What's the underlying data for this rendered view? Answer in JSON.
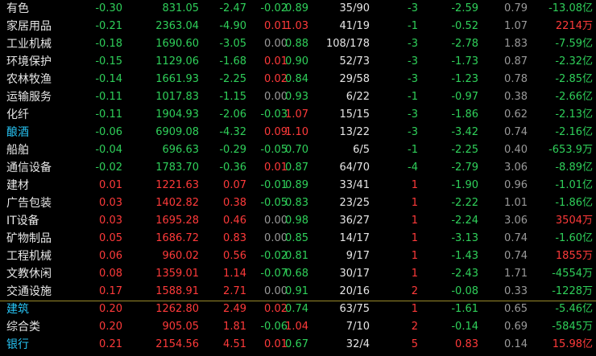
{
  "columns": [
    "name",
    "chg",
    "price",
    "up",
    "speed",
    "lb",
    "updown",
    "daychg",
    "c8",
    "c9",
    "c10"
  ],
  "rows": [
    {
      "name": "有色",
      "name_color": "white",
      "chg": "-0.30",
      "price": "831.05",
      "up": "-2.47",
      "speed": "-0.02",
      "lb": "0.89",
      "updown": "35/90",
      "daychg": "-3",
      "c8": "-2.59",
      "c9": "0.79",
      "c10": "-13.08亿",
      "colors": {
        "chg": "green",
        "price": "green",
        "up": "green",
        "speed": "green",
        "lb": "green",
        "updown": "white",
        "daychg": "green",
        "c8": "green",
        "c9": "gray",
        "c10": "green"
      }
    },
    {
      "name": "家居用品",
      "name_color": "white",
      "chg": "-0.21",
      "price": "2363.04",
      "up": "-4.90",
      "speed": "0.01",
      "lb": "1.03",
      "updown": "41/19",
      "daychg": "-1",
      "c8": "-0.52",
      "c9": "1.07",
      "c10": "2214万",
      "colors": {
        "chg": "green",
        "price": "green",
        "up": "green",
        "speed": "red",
        "lb": "red",
        "updown": "white",
        "daychg": "green",
        "c8": "green",
        "c9": "gray",
        "c10": "red"
      }
    },
    {
      "name": "工业机械",
      "name_color": "white",
      "chg": "-0.18",
      "price": "1690.60",
      "up": "-3.05",
      "speed": "0.00",
      "lb": "0.88",
      "updown": "108/178",
      "daychg": "-3",
      "c8": "-2.78",
      "c9": "1.83",
      "c10": "-7.59亿",
      "colors": {
        "chg": "green",
        "price": "green",
        "up": "green",
        "speed": "gray",
        "lb": "green",
        "updown": "white",
        "daychg": "green",
        "c8": "green",
        "c9": "gray",
        "c10": "green"
      }
    },
    {
      "name": "环境保护",
      "name_color": "white",
      "chg": "-0.15",
      "price": "1129.06",
      "up": "-1.68",
      "speed": "0.01",
      "lb": "0.90",
      "updown": "52/73",
      "daychg": "-3",
      "c8": "-1.73",
      "c9": "0.87",
      "c10": "-2.32亿",
      "colors": {
        "chg": "green",
        "price": "green",
        "up": "green",
        "speed": "red",
        "lb": "green",
        "updown": "white",
        "daychg": "green",
        "c8": "green",
        "c9": "gray",
        "c10": "green"
      }
    },
    {
      "name": "农林牧渔",
      "name_color": "white",
      "chg": "-0.14",
      "price": "1661.93",
      "up": "-2.25",
      "speed": "0.02",
      "lb": "0.84",
      "updown": "29/58",
      "daychg": "-3",
      "c8": "-1.23",
      "c9": "0.78",
      "c10": "-2.85亿",
      "colors": {
        "chg": "green",
        "price": "green",
        "up": "green",
        "speed": "red",
        "lb": "green",
        "updown": "white",
        "daychg": "green",
        "c8": "green",
        "c9": "gray",
        "c10": "green"
      }
    },
    {
      "name": "运输服务",
      "name_color": "white",
      "chg": "-0.11",
      "price": "1017.83",
      "up": "-1.15",
      "speed": "0.00",
      "lb": "0.93",
      "updown": "6/22",
      "daychg": "-1",
      "c8": "-0.97",
      "c9": "0.38",
      "c10": "-2.66亿",
      "colors": {
        "chg": "green",
        "price": "green",
        "up": "green",
        "speed": "gray",
        "lb": "green",
        "updown": "white",
        "daychg": "green",
        "c8": "green",
        "c9": "gray",
        "c10": "green"
      }
    },
    {
      "name": "化纤",
      "name_color": "white",
      "chg": "-0.11",
      "price": "1904.93",
      "up": "-2.06",
      "speed": "-0.03",
      "lb": "1.07",
      "updown": "15/15",
      "daychg": "-3",
      "c8": "-1.86",
      "c9": "0.62",
      "c10": "-2.13亿",
      "colors": {
        "chg": "green",
        "price": "green",
        "up": "green",
        "speed": "green",
        "lb": "red",
        "updown": "white",
        "daychg": "green",
        "c8": "green",
        "c9": "gray",
        "c10": "green"
      }
    },
    {
      "name": "酿酒",
      "name_color": "cyan",
      "chg": "-0.06",
      "price": "6909.08",
      "up": "-4.32",
      "speed": "0.09",
      "lb": "1.10",
      "updown": "13/22",
      "daychg": "-3",
      "c8": "-3.42",
      "c9": "0.74",
      "c10": "-2.16亿",
      "colors": {
        "chg": "green",
        "price": "green",
        "up": "green",
        "speed": "red",
        "lb": "red",
        "updown": "white",
        "daychg": "green",
        "c8": "green",
        "c9": "gray",
        "c10": "green"
      }
    },
    {
      "name": "船舶",
      "name_color": "white",
      "chg": "-0.04",
      "price": "696.63",
      "up": "-0.29",
      "speed": "-0.05",
      "lb": "0.70",
      "updown": "6/5",
      "daychg": "-1",
      "c8": "-2.25",
      "c9": "0.40",
      "c10": "-653.9万",
      "colors": {
        "chg": "green",
        "price": "green",
        "up": "green",
        "speed": "green",
        "lb": "green",
        "updown": "white",
        "daychg": "green",
        "c8": "green",
        "c9": "gray",
        "c10": "green"
      }
    },
    {
      "name": "通信设备",
      "name_color": "white",
      "chg": "-0.02",
      "price": "1783.70",
      "up": "-0.36",
      "speed": "0.01",
      "lb": "0.87",
      "updown": "64/70",
      "daychg": "-4",
      "c8": "-2.79",
      "c9": "3.06",
      "c10": "-8.89亿",
      "colors": {
        "chg": "green",
        "price": "green",
        "up": "green",
        "speed": "red",
        "lb": "green",
        "updown": "white",
        "daychg": "green",
        "c8": "green",
        "c9": "gray",
        "c10": "green"
      }
    },
    {
      "name": "建材",
      "name_color": "white",
      "chg": "0.01",
      "price": "1221.63",
      "up": "0.07",
      "speed": "-0.01",
      "lb": "0.89",
      "updown": "33/41",
      "daychg": "1",
      "c8": "-1.90",
      "c9": "0.96",
      "c10": "-1.01亿",
      "colors": {
        "chg": "red",
        "price": "red",
        "up": "red",
        "speed": "green",
        "lb": "green",
        "updown": "white",
        "daychg": "red",
        "c8": "green",
        "c9": "gray",
        "c10": "green"
      }
    },
    {
      "name": "广告包装",
      "name_color": "white",
      "chg": "0.03",
      "price": "1402.82",
      "up": "0.38",
      "speed": "-0.05",
      "lb": "0.83",
      "updown": "23/25",
      "daychg": "1",
      "c8": "-2.22",
      "c9": "1.01",
      "c10": "-1.86亿",
      "colors": {
        "chg": "red",
        "price": "red",
        "up": "red",
        "speed": "green",
        "lb": "green",
        "updown": "white",
        "daychg": "red",
        "c8": "green",
        "c9": "gray",
        "c10": "green"
      }
    },
    {
      "name": "IT设备",
      "name_color": "white",
      "chg": "0.03",
      "price": "1695.28",
      "up": "0.46",
      "speed": "0.00",
      "lb": "0.98",
      "updown": "36/27",
      "daychg": "1",
      "c8": "-2.24",
      "c9": "3.06",
      "c10": "3504万",
      "colors": {
        "chg": "red",
        "price": "red",
        "up": "red",
        "speed": "gray",
        "lb": "green",
        "updown": "white",
        "daychg": "red",
        "c8": "green",
        "c9": "gray",
        "c10": "red"
      }
    },
    {
      "name": "矿物制品",
      "name_color": "white",
      "chg": "0.05",
      "price": "1686.72",
      "up": "0.83",
      "speed": "0.00",
      "lb": "0.85",
      "updown": "14/17",
      "daychg": "1",
      "c8": "-3.13",
      "c9": "0.74",
      "c10": "-1.60亿",
      "colors": {
        "chg": "red",
        "price": "red",
        "up": "red",
        "speed": "gray",
        "lb": "green",
        "updown": "white",
        "daychg": "red",
        "c8": "green",
        "c9": "gray",
        "c10": "green"
      }
    },
    {
      "name": "工程机械",
      "name_color": "white",
      "chg": "0.06",
      "price": "960.02",
      "up": "0.56",
      "speed": "-0.02",
      "lb": "0.81",
      "updown": "9/17",
      "daychg": "1",
      "c8": "-1.43",
      "c9": "0.74",
      "c10": "1855万",
      "colors": {
        "chg": "red",
        "price": "red",
        "up": "red",
        "speed": "green",
        "lb": "green",
        "updown": "white",
        "daychg": "red",
        "c8": "green",
        "c9": "gray",
        "c10": "red"
      }
    },
    {
      "name": "文教休闲",
      "name_color": "white",
      "chg": "0.08",
      "price": "1359.01",
      "up": "1.14",
      "speed": "-0.07",
      "lb": "0.68",
      "updown": "30/17",
      "daychg": "1",
      "c8": "-2.43",
      "c9": "1.71",
      "c10": "-4554万",
      "colors": {
        "chg": "red",
        "price": "red",
        "up": "red",
        "speed": "green",
        "lb": "green",
        "updown": "white",
        "daychg": "red",
        "c8": "green",
        "c9": "gray",
        "c10": "green"
      }
    },
    {
      "name": "交通设施",
      "name_color": "white",
      "chg": "0.17",
      "price": "1588.91",
      "up": "2.71",
      "speed": "0.00",
      "lb": "0.91",
      "updown": "20/16",
      "daychg": "2",
      "c8": "-0.08",
      "c9": "0.33",
      "c10": "-1228万",
      "colors": {
        "chg": "red",
        "price": "red",
        "up": "red",
        "speed": "gray",
        "lb": "green",
        "updown": "white",
        "daychg": "red",
        "c8": "green",
        "c9": "gray",
        "c10": "green"
      }
    },
    {
      "name": "建筑",
      "name_color": "cyan",
      "chg": "0.20",
      "price": "1262.80",
      "up": "2.49",
      "speed": "0.02",
      "lb": "0.74",
      "updown": "63/75",
      "daychg": "1",
      "c8": "-1.61",
      "c9": "0.65",
      "c10": "-5.46亿",
      "colors": {
        "chg": "red",
        "price": "red",
        "up": "red",
        "speed": "red",
        "lb": "green",
        "updown": "white",
        "daychg": "red",
        "c8": "green",
        "c9": "gray",
        "c10": "green"
      }
    },
    {
      "name": "综合类",
      "name_color": "white",
      "chg": "0.20",
      "price": "905.05",
      "up": "1.81",
      "speed": "-0.06",
      "lb": "1.04",
      "updown": "7/10",
      "daychg": "2",
      "c8": "-0.14",
      "c9": "0.69",
      "c10": "-5845万",
      "colors": {
        "chg": "red",
        "price": "red",
        "up": "red",
        "speed": "green",
        "lb": "red",
        "updown": "white",
        "daychg": "red",
        "c8": "green",
        "c9": "gray",
        "c10": "green"
      }
    },
    {
      "name": "银行",
      "name_color": "cyan",
      "chg": "0.21",
      "price": "2154.56",
      "up": "4.51",
      "speed": "0.01",
      "lb": "0.67",
      "updown": "32/4",
      "daychg": "5",
      "c8": "0.83",
      "c9": "0.14",
      "c10": "15.98亿",
      "colors": {
        "chg": "red",
        "price": "red",
        "up": "red",
        "speed": "red",
        "lb": "green",
        "updown": "white",
        "daychg": "red",
        "c8": "red",
        "c9": "gray",
        "c10": "red"
      }
    }
  ],
  "separator_after_row": 16,
  "palette": {
    "red": "#ff3a3a",
    "green": "#2fd05a",
    "cyan": "#27c3f3",
    "white": "#e6e6e6",
    "gray": "#9a9a9a",
    "separator": "#9a8a2a"
  }
}
